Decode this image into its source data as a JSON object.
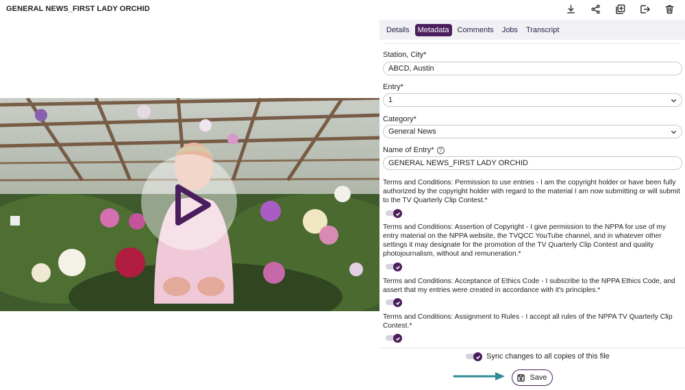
{
  "header": {
    "title": "GENERAL NEWS_FIRST LADY ORCHID"
  },
  "toolbar": [
    {
      "icon": "download-icon"
    },
    {
      "icon": "share-icon"
    },
    {
      "icon": "copy-add-icon"
    },
    {
      "icon": "export-icon"
    },
    {
      "icon": "trash-icon"
    }
  ],
  "tabs": [
    {
      "label": "Details",
      "active": false
    },
    {
      "label": "Metadata",
      "active": true
    },
    {
      "label": "Comments",
      "active": false
    },
    {
      "label": "Jobs",
      "active": false
    },
    {
      "label": "Transcript",
      "active": false
    }
  ],
  "form": {
    "station": {
      "label": "Station, City*",
      "value": "ABCD, Austin"
    },
    "entry": {
      "label": "Entry*",
      "value": "1"
    },
    "category": {
      "label": "Category*",
      "value": "General News"
    },
    "name": {
      "label": "Name of Entry*",
      "value": "GENERAL NEWS_FIRST LADY ORCHID"
    },
    "terms": [
      {
        "text": "Terms and Conditions: Permission to use entries - I am the copyright holder or have been fully authorized by the copyright holder with regard to the material I am now submitting or will submit to the TV Quarterly Clip Contest.*",
        "checked": true
      },
      {
        "text": "Terms and Conditions: Assertion of Copyright - I give permission to the NPPA for use of my entry material on the NPPA website, the TVQCC YouTube channel, and in whatever other settings it may designate for the promotion of the TV Quarterly Clip Contest and quality photojournalism, without and remuneration.*",
        "checked": true
      },
      {
        "text": "Terms and Conditions: Acceptance of Ethics Code - I subscribe to the NPPA Ethics Code, and assert that my entries were created in accordance with it's principles.*",
        "checked": true
      },
      {
        "text": "Terms and Conditions: Assignment to Rules - I accept all rules of the NPPA TV Quarterly Clip Contest.*",
        "checked": true
      }
    ]
  },
  "footer": {
    "sync_label": "Sync changes to all copies of this file",
    "sync_checked": true,
    "save_label": "Save"
  },
  "colors": {
    "accent": "#4a1e5c",
    "arrow": "#2f8a96"
  }
}
